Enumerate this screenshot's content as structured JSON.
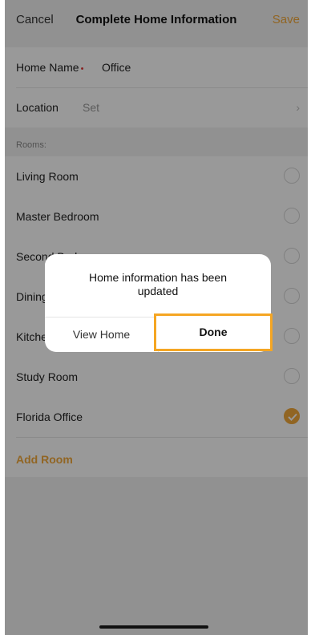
{
  "nav": {
    "cancel": "Cancel",
    "title": "Complete Home Information",
    "save": "Save"
  },
  "form": {
    "home_name_label": "Home Name",
    "required_mark": "•",
    "home_name_value": "Office",
    "location_label": "Location",
    "location_value": "Set",
    "chevron": "›"
  },
  "rooms": {
    "header": "Rooms:",
    "items": [
      {
        "label": "Living Room",
        "checked": false
      },
      {
        "label": "Master Bedroom",
        "checked": false
      },
      {
        "label": "Second Bedroom",
        "checked": false
      },
      {
        "label": "Dining Room",
        "checked": false
      },
      {
        "label": "Kitchen",
        "checked": false
      },
      {
        "label": "Study Room",
        "checked": false
      },
      {
        "label": "Florida Office",
        "checked": true
      }
    ],
    "add_room": "Add Room"
  },
  "dialog": {
    "message": "Home information has been updated",
    "left_button": "View Home",
    "right_button": "Done"
  },
  "colors": {
    "accent": "#f2a93b",
    "highlight": "#f5a623"
  }
}
